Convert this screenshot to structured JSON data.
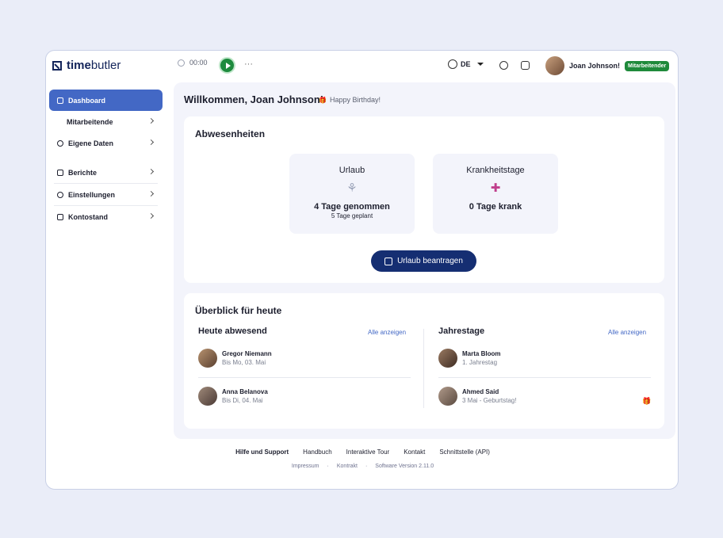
{
  "app": {
    "logo_bold": "time",
    "logo_light": "butler"
  },
  "topbar": {
    "timer": "00:00",
    "more": "···",
    "language": "DE",
    "user_name": "Joan Johnson!",
    "user_badge": "Mitarbeitender"
  },
  "sidebar": {
    "items": [
      {
        "label": "Dashboard"
      },
      {
        "label": "Mitarbeitende"
      },
      {
        "label": "Eigene Daten"
      },
      {
        "label": "Berichte"
      },
      {
        "label": "Einstellungen"
      },
      {
        "label": "Kontostand"
      }
    ]
  },
  "main": {
    "welcome": "Willkommen, Joan Johnson!",
    "birthday": "Happy Birthday!",
    "absences": {
      "title": "Abwesenheiten",
      "vacation": {
        "label": "Urlaub",
        "taken": "4 Tage genommen",
        "planned": "5 Tage geplant"
      },
      "sick": {
        "label": "Krankheitstage",
        "value": "0 Tage krank"
      },
      "request_button": "Urlaub beantragen"
    },
    "overview": {
      "title": "Überblick für heute",
      "absent_title": "Heute abwesend",
      "absent_show_all": "Alle anzeigen",
      "absent": [
        {
          "name": "Gregor Niemann",
          "desc": "Bis Mo, 03. Mai"
        },
        {
          "name": "Anna Belanova",
          "desc": "Bis Di, 04. Mai"
        }
      ],
      "anniv_title": "Jahrestage",
      "anniv_show_all": "Alle anzeigen",
      "anniversaries": [
        {
          "name": "Marta Bloom",
          "desc": "1. Jahrestag"
        },
        {
          "name": "Ahmed Said",
          "desc": "3 Mai - Geburtstag!"
        }
      ]
    }
  },
  "footer": {
    "help": "Hilfe und Support",
    "links": [
      "Handbuch",
      "Interaktive Tour",
      "Kontakt",
      "Schnittstelle (API)"
    ],
    "meta": [
      "Impressum",
      "Kontrakt",
      "Software Version 2.11.0"
    ]
  },
  "colors": {
    "accent": "#4368c5",
    "primary": "#152e72",
    "success": "#1f8a3b"
  }
}
